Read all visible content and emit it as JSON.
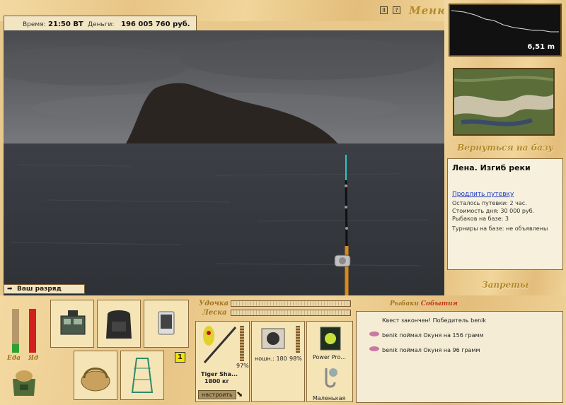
{
  "topbar": {
    "time_label": "Время:",
    "time_value": "21:50 ВТ",
    "money_label": "Деньги:",
    "money_value": "196 005 760 руб.",
    "pause_icon": "II",
    "help_icon": "?",
    "menu_label": "Меню"
  },
  "scene": {
    "rank_message": "Ваш разряд вырос!"
  },
  "depth": {
    "value": "6,51 m"
  },
  "location": {
    "back_to_base": "Вернуться на базу",
    "title": "Лена. Изгиб реки",
    "extend_link": "Продлить путевку",
    "lines": [
      "Осталось путевки: 2 час.",
      "Стоимость дня: 30 000 руб.",
      "Рыбаков на базе: 3",
      "Турниры на базе: не объявлены"
    ],
    "bans": "Запреты"
  },
  "status": {
    "food_label": "Еда",
    "poison_label": "Яд",
    "food_level": 0.2,
    "poison_level": 1.0
  },
  "inventory": {
    "tackle_icon": "tackle-box-icon",
    "backpack_icon": "backpack-icon",
    "phone_icon": "phone-icon",
    "basket_icon": "picnic-basket-icon",
    "keepnet_icon": "keepnet-icon",
    "bag_icon": "bait-bag-icon",
    "slot_number": "1"
  },
  "tackle": {
    "rod_label": "Удочка",
    "line_label": "Леска",
    "rod_name": "Tiger Sha...",
    "rod_weight": "1800 кг",
    "rod_percent": "97%",
    "configure_button": "настроить",
    "reel_label": "ношн.: 180",
    "reel_percent": "98%",
    "line_name": "Power Pro...",
    "hook_name": "Маленькая"
  },
  "events": {
    "title_part1": "Рыбаки",
    "title_part2": "События",
    "items": [
      "Квест закончен! Победитель benik",
      "benik поймал Окуня на 156 грамм",
      "benik поймал Окуня на 96 грамм"
    ]
  }
}
